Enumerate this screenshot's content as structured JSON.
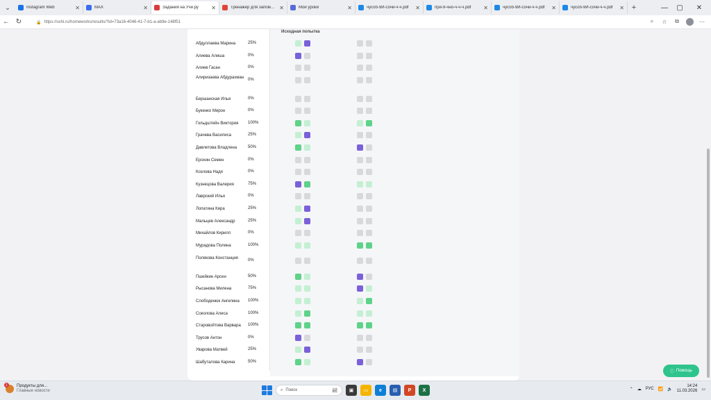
{
  "browser": {
    "tabs": [
      {
        "title": "Instagram Web",
        "color": "#1a73e8",
        "active": false
      },
      {
        "title": "MAX",
        "color": "#3c6df0",
        "active": false
      },
      {
        "title": "Задания на Учи.ру",
        "color": "#d93b3b",
        "active": true
      },
      {
        "title": "Тренажер для запоминания",
        "color": "#e0453a",
        "active": false
      },
      {
        "title": "Мои уроки",
        "color": "#5b6bd6",
        "active": false
      },
      {
        "title": "чусоб-9И-сочи-ч-ч.pdf",
        "color": "#1e88e5",
        "active": false
      },
      {
        "title": "при-9-чно-ч-ч-ч.pdf",
        "color": "#1e88e5",
        "active": false
      },
      {
        "title": "чусоб-9И-сочи-ч-ч.pdf",
        "color": "#1e88e5",
        "active": false
      },
      {
        "title": "чусоб-9И-сочи-ч-ч.pdf",
        "color": "#1e88e5",
        "active": false
      }
    ],
    "url": "https://uchi.ru/homeworks/results/?id=73a16-4046-41-7-b1-a-ab9e-148f51"
  },
  "column_header": "Исходная попытка",
  "students": [
    {
      "name": "Абдуллаева Марина",
      "score": "25%",
      "a": [
        "lgreen",
        "purple"
      ],
      "b": [
        "gray",
        "gray"
      ]
    },
    {
      "name": "Алиева Алиша",
      "score": "0%",
      "a": [
        "purple",
        "gray"
      ],
      "b": [
        "gray",
        "gray"
      ]
    },
    {
      "name": "Алиев Гасан",
      "score": "0%",
      "a": [
        "gray",
        "gray"
      ],
      "b": [
        "gray",
        "gray"
      ]
    },
    {
      "name": "Алиризаева Абдурахман",
      "score": "0%",
      "a": [
        "gray",
        "gray"
      ],
      "b": [
        "gray",
        "gray"
      ]
    },
    {
      "name": "Бершанская Илья",
      "score": "0%",
      "a": [
        "gray",
        "gray"
      ],
      "b": [
        "gray",
        "gray"
      ]
    },
    {
      "name": "Букенко Мирон",
      "score": "0%",
      "a": [
        "gray",
        "gray"
      ],
      "b": [
        "gray",
        "gray"
      ]
    },
    {
      "name": "Гольдштейн Виктория",
      "score": "100%",
      "a": [
        "green",
        "lgreen"
      ],
      "b": [
        "lgreen",
        "green"
      ]
    },
    {
      "name": "Грачева Василиса",
      "score": "25%",
      "a": [
        "lgreen",
        "purple"
      ],
      "b": [
        "gray",
        "gray"
      ]
    },
    {
      "name": "Давлетова Владлена",
      "score": "50%",
      "a": [
        "green",
        "lgreen"
      ],
      "b": [
        "purple",
        "gray"
      ]
    },
    {
      "name": "Ерохин Семен",
      "score": "0%",
      "a": [
        "gray",
        "gray"
      ],
      "b": [
        "gray",
        "gray"
      ]
    },
    {
      "name": "Козлова Надя",
      "score": "0%",
      "a": [
        "gray",
        "gray"
      ],
      "b": [
        "gray",
        "gray"
      ]
    },
    {
      "name": "Кузнецова Валерия",
      "score": "75%",
      "a": [
        "purple",
        "green"
      ],
      "b": [
        "lgreen",
        "lgreen"
      ]
    },
    {
      "name": "Лаврский Илья",
      "score": "0%",
      "a": [
        "gray",
        "gray"
      ],
      "b": [
        "gray",
        "gray"
      ]
    },
    {
      "name": "Лопатина Кира",
      "score": "25%",
      "a": [
        "lgreen",
        "purple"
      ],
      "b": [
        "gray",
        "gray"
      ]
    },
    {
      "name": "Мальцев Александр",
      "score": "25%",
      "a": [
        "lgreen",
        "purple"
      ],
      "b": [
        "gray",
        "gray"
      ]
    },
    {
      "name": "Михайлов Кирилл",
      "score": "0%",
      "a": [
        "gray",
        "gray"
      ],
      "b": [
        "gray",
        "gray"
      ]
    },
    {
      "name": "Мурадова Полина",
      "score": "100%",
      "a": [
        "lgreen",
        "lgreen"
      ],
      "b": [
        "green",
        "green"
      ]
    },
    {
      "name": "Полякова Констанция",
      "score": "0%",
      "a": [
        "gray",
        "gray"
      ],
      "b": [
        "gray",
        "gray"
      ]
    },
    {
      "name": "Пшейкин Арсен",
      "score": "50%",
      "a": [
        "green",
        "lgreen"
      ],
      "b": [
        "purple",
        "gray"
      ]
    },
    {
      "name": "Рысанова Милена",
      "score": "75%",
      "a": [
        "lgreen",
        "lgreen"
      ],
      "b": [
        "purple",
        "lgreen"
      ]
    },
    {
      "name": "Слободенюк Ангелина",
      "score": "100%",
      "a": [
        "lgreen",
        "lgreen"
      ],
      "b": [
        "lgreen",
        "green"
      ]
    },
    {
      "name": "Соколова Алиса",
      "score": "100%",
      "a": [
        "lgreen",
        "green"
      ],
      "b": [
        "lgreen",
        "lgreen"
      ]
    },
    {
      "name": "Старовойтова Варвара",
      "score": "100%",
      "a": [
        "green",
        "green"
      ],
      "b": [
        "green",
        "green"
      ]
    },
    {
      "name": "Трусов Антон",
      "score": "0%",
      "a": [
        "purple",
        "gray"
      ],
      "b": [
        "gray",
        "gray"
      ]
    },
    {
      "name": "Уварова Матвей",
      "score": "25%",
      "a": [
        "lgreen",
        "purple"
      ],
      "b": [
        "gray",
        "gray"
      ]
    },
    {
      "name": "Шабуталова Карина",
      "score": "50%",
      "a": [
        "green",
        "lgreen"
      ],
      "b": [
        "purple",
        "gray"
      ]
    }
  ],
  "help_button": "Помощь",
  "taskbar": {
    "weather_title": "Продукты для...",
    "weather_sub": "Главные новости",
    "search_placeholder": "Поиск",
    "lang": "РУС",
    "time": "14:24",
    "date": "11.03.2026"
  },
  "colors": {
    "gray": "#d9d9dd",
    "green": "#5fd28a",
    "lgreen": "#c4efd3",
    "purple": "#7b61d9",
    "help": "#2ec48b"
  }
}
